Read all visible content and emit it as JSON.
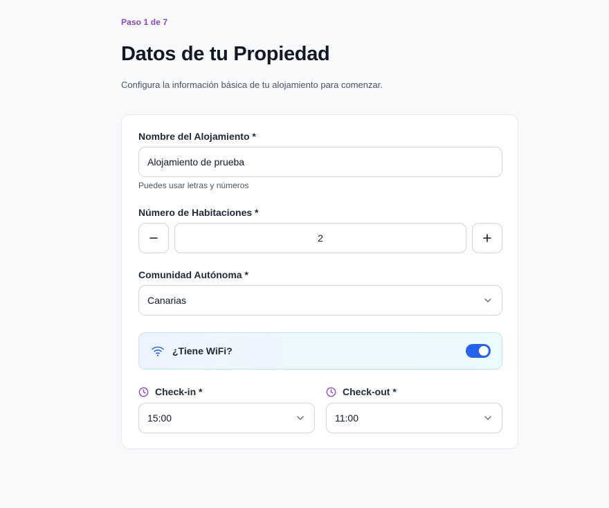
{
  "header": {
    "step": "Paso 1 de 7",
    "title": "Datos de tu Propiedad",
    "subtitle": "Configura la información básica de tu alojamiento para comenzar."
  },
  "form": {
    "name": {
      "label": "Nombre del Alojamiento *",
      "value": "Alojamiento de prueba",
      "hint": "Puedes usar letras y números"
    },
    "rooms": {
      "label": "Número de Habitaciones *",
      "value": "2",
      "decrement": "−",
      "increment": "+"
    },
    "region": {
      "label": "Comunidad Autónoma *",
      "value": "Canarias"
    },
    "wifi": {
      "label": "¿Tiene WiFi?",
      "enabled": true
    },
    "checkin": {
      "label": "Check-in *",
      "value": "15:00"
    },
    "checkout": {
      "label": "Check-out *",
      "value": "11:00"
    }
  },
  "icons": {
    "wifi": "wifi-icon",
    "clock": "clock-icon",
    "chevron": "chevron-down-icon"
  },
  "colors": {
    "accent_purple": "#8b46c9",
    "toggle_blue": "#2563eb",
    "wifi_icon_blue": "#2f6fdb"
  }
}
